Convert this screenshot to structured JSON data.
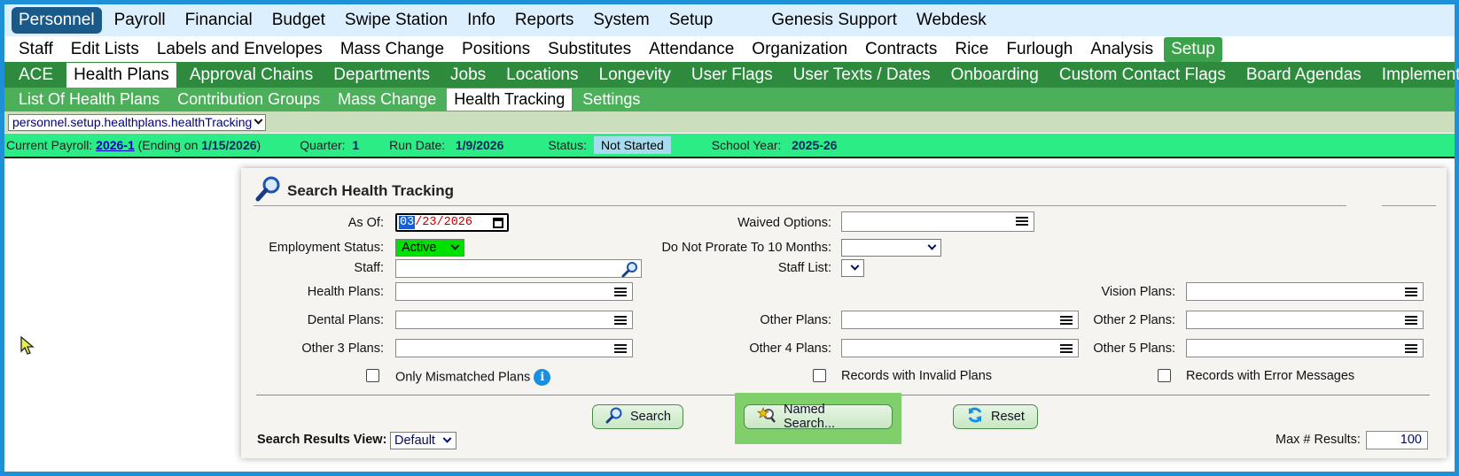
{
  "nav": {
    "main": [
      "Personnel",
      "Payroll",
      "Financial",
      "Budget",
      "Swipe Station",
      "Info",
      "Reports",
      "System",
      "Setup"
    ],
    "main_right": [
      "Genesis Support",
      "Webdesk"
    ],
    "sub": [
      "Staff",
      "Edit Lists",
      "Labels and Envelopes",
      "Mass Change",
      "Positions",
      "Substitutes",
      "Attendance",
      "Organization",
      "Contracts",
      "Rice",
      "Furlough",
      "Analysis",
      "Setup"
    ],
    "setup": [
      "ACE",
      "Health Plans",
      "Approval Chains",
      "Departments",
      "Jobs",
      "Locations",
      "Longevity",
      "User Flags",
      "User Texts / Dates",
      "Onboarding",
      "Custom Contact Flags",
      "Board Agendas",
      "Implementation"
    ],
    "health": [
      "List Of Health Plans",
      "Contribution Groups",
      "Mass Change",
      "Health Tracking",
      "Settings"
    ]
  },
  "route": "personnel.setup.healthplans.healthTracking",
  "payroll_bar": {
    "current_label": "Current Payroll:",
    "payroll_id": "2026-1",
    "ending_pre": "(Ending on",
    "ending_date": "1/15/2026",
    "ending_post": ")",
    "quarter_label": "Quarter:",
    "quarter": "1",
    "run_date_label": "Run Date:",
    "run_date": "1/9/2026",
    "status_label": "Status:",
    "status": "Not Started",
    "school_year_label": "School Year:",
    "school_year": "2025-26"
  },
  "search": {
    "title": "Search Health Tracking",
    "as_of_label": "As Of:",
    "as_of_mm": "03",
    "as_of_rest": "/23/2026",
    "employment_status_label": "Employment Status:",
    "employment_status": "Active",
    "staff_label": "Staff:",
    "health_plans_label": "Health Plans:",
    "dental_plans_label": "Dental Plans:",
    "other3_label": "Other 3 Plans:",
    "waived_label": "Waived Options:",
    "prorate_label": "Do Not Prorate To 10 Months:",
    "staff_list_label": "Staff List:",
    "other_plans_label": "Other Plans:",
    "other4_label": "Other 4 Plans:",
    "vision_label": "Vision Plans:",
    "other2_label": "Other 2 Plans:",
    "other5_label": "Other 5 Plans:",
    "only_mismatched": "Only Mismatched Plans",
    "invalid_plans": "Records with Invalid Plans",
    "error_messages": "Records with Error Messages",
    "search_btn": "Search",
    "named_search_btn": "Named Search...",
    "reset_btn": "Reset",
    "results_view_label": "Search Results View:",
    "results_view": "Default",
    "max_results_label": "Max # Results:",
    "max_results": "100"
  },
  "colors": {
    "nav_active": "#1a5a8a",
    "setup_green": "#2e8b3e",
    "status_bar": "#2bec85"
  },
  "icons": [
    "magnifier-icon",
    "info-icon",
    "star-search-icon",
    "refresh-icon",
    "calendar-icon",
    "mouse-cursor-icon"
  ]
}
